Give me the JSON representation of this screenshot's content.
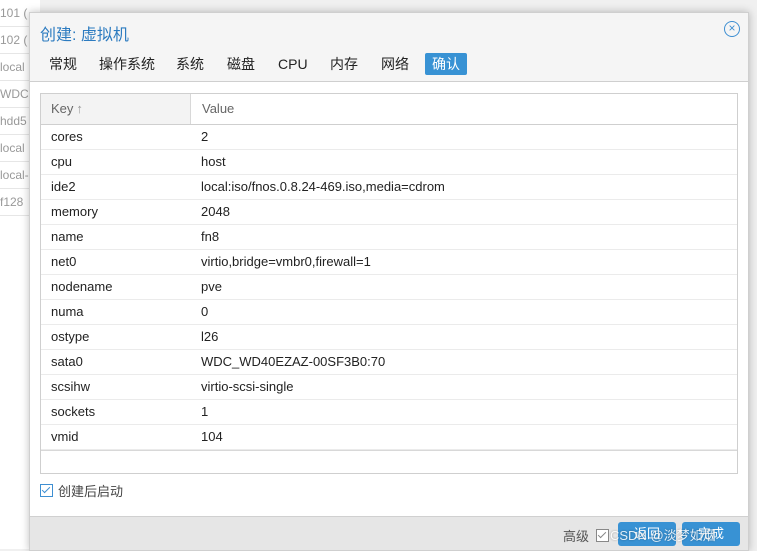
{
  "background_list": [
    "101 (",
    "102 (",
    "local",
    "WDC",
    "hdd5",
    "local",
    "local-",
    "f128"
  ],
  "dialog": {
    "title": "创建: 虚拟机",
    "close_icon": "close-circle-icon",
    "tabs": [
      {
        "label": "常规",
        "active": false
      },
      {
        "label": "操作系统",
        "active": false
      },
      {
        "label": "系统",
        "active": false
      },
      {
        "label": "磁盘",
        "active": false
      },
      {
        "label": "CPU",
        "active": false
      },
      {
        "label": "内存",
        "active": false
      },
      {
        "label": "网络",
        "active": false
      },
      {
        "label": "确认",
        "active": true
      }
    ]
  },
  "table": {
    "columns": [
      "Key",
      "Value"
    ],
    "sort_icon": "↑",
    "rows": [
      {
        "key": "cores",
        "value": "2"
      },
      {
        "key": "cpu",
        "value": "host"
      },
      {
        "key": "ide2",
        "value": "local:iso/fnos.0.8.24-469.iso,media=cdrom"
      },
      {
        "key": "memory",
        "value": "2048"
      },
      {
        "key": "name",
        "value": "fn8"
      },
      {
        "key": "net0",
        "value": "virtio,bridge=vmbr0,firewall=1"
      },
      {
        "key": "nodename",
        "value": "pve"
      },
      {
        "key": "numa",
        "value": "0"
      },
      {
        "key": "ostype",
        "value": "l26"
      },
      {
        "key": "sata0",
        "value": "WDC_WD40EZAZ-00SF3B0:70"
      },
      {
        "key": "scsihw",
        "value": "virtio-scsi-single"
      },
      {
        "key": "sockets",
        "value": "1"
      },
      {
        "key": "vmid",
        "value": "104"
      }
    ]
  },
  "autostart_label": "创建后启动",
  "autostart_checked": true,
  "footer": {
    "advanced_label": "高级",
    "advanced_checked": true,
    "back_label": "返回",
    "finish_label": "完成"
  },
  "watermark": "CSDN @淡梦如烟",
  "colors": {
    "accent": "#3892d4",
    "title": "#2c7bc0"
  }
}
